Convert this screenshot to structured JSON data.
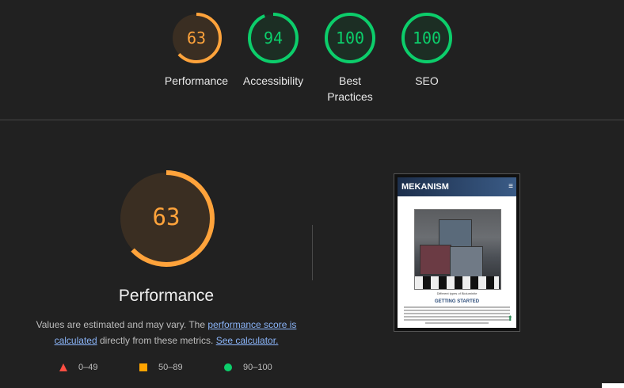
{
  "summary": {
    "gauges": [
      {
        "score": "63",
        "label": "Performance",
        "color": "#ffa33b",
        "fraction": 0.63
      },
      {
        "score": "94",
        "label": "Accessibility",
        "color": "#0cce6b",
        "fraction": 0.94
      },
      {
        "score": "100",
        "label": "Best Practices",
        "color": "#0cce6b",
        "fraction": 1.0
      },
      {
        "score": "100",
        "label": "SEO",
        "color": "#0cce6b",
        "fraction": 1.0
      }
    ]
  },
  "performance": {
    "score": "63",
    "fraction": 0.63,
    "color": "#ffa33b",
    "title": "Performance",
    "note_prefix": "Values are estimated and may vary. The ",
    "note_link1": "performance score is calculated",
    "note_middle": " directly from these metrics. ",
    "note_link2": "See calculator."
  },
  "legend": [
    {
      "range": "0–49",
      "shape": "triangle",
      "color": "#ff4e42"
    },
    {
      "range": "50–89",
      "shape": "square",
      "color": "#ffa400"
    },
    {
      "range": "90–100",
      "shape": "circle",
      "color": "#0cce6b"
    }
  ],
  "screenshot": {
    "site_title": "MEKANISM",
    "caption": "Different types of Bioluminite",
    "subheading": "GETTING STARTED"
  }
}
